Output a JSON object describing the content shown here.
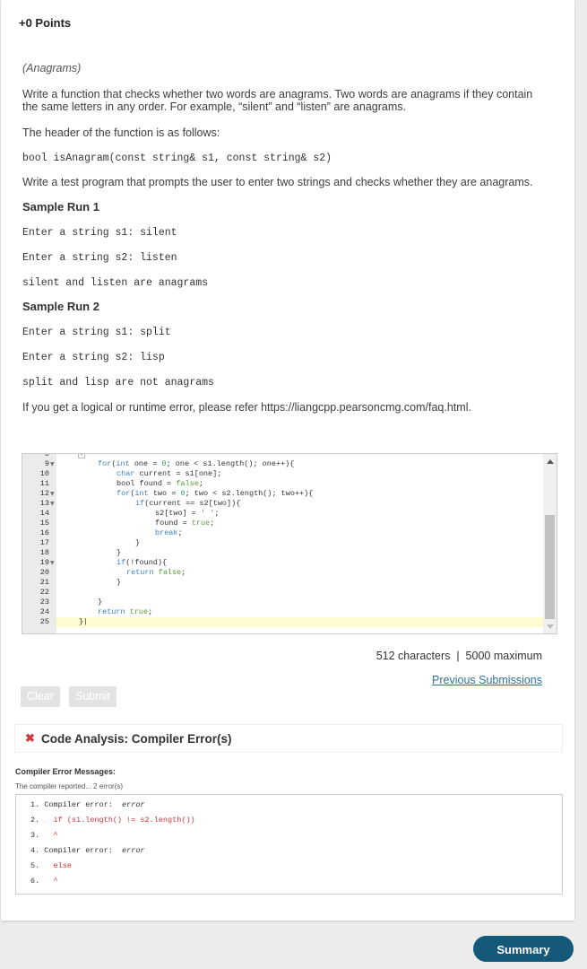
{
  "header": {
    "points": "+0 Points"
  },
  "problem": {
    "title": "(Anagrams)",
    "desc_line1": "Write a function that checks whether two words are anagrams. Two words are anagrams if they contain",
    "desc_line2": "the same letters in any order. For example, “silent” and “listen” are anagrams.",
    "header_intro": "The header of the function is as follows:",
    "signature": "bool isAnagram(const string& s1, const string& s2)",
    "test_desc": "Write a test program that prompts the user to enter two strings and checks whether they are anagrams.",
    "sample1_title": "Sample Run 1",
    "sample1_lines": [
      "Enter a string s1: silent",
      "Enter a string s2: listen",
      "silent and listen are anagrams"
    ],
    "sample2_title": "Sample Run 2",
    "sample2_lines": [
      "Enter a string s1: split",
      "Enter a string s2: lisp",
      "split and lisp are not anagrams"
    ],
    "error_note": "If you get a logical or runtime error, please refer https://liangcpp.pearsoncmg.com/faq.html."
  },
  "editor": {
    "line_numbers": [
      "9",
      "10",
      "11",
      "12",
      "13",
      "14",
      "15",
      "16",
      "17",
      "18",
      "19",
      "20",
      "21",
      "22",
      "23",
      "24",
      "25"
    ],
    "folded_marker": "↕"
  },
  "footer": {
    "char_count": "512 characters",
    "separator": "|",
    "max_chars": "5000 maximum",
    "previous_submissions": "Previous Submissions",
    "clear_label": "Clear",
    "submit_label": "Submit"
  },
  "analysis": {
    "icon": "close-icon",
    "title": "Code Analysis: Compiler Error(s)",
    "messages_label": "Compiler Error Messages:",
    "reported": "The compiler reported... 2 error(s)"
  },
  "summary_label": "Summary",
  "colors": {
    "accent": "#14587a",
    "error": "#d23b3b",
    "link": "#2a6fa8"
  }
}
